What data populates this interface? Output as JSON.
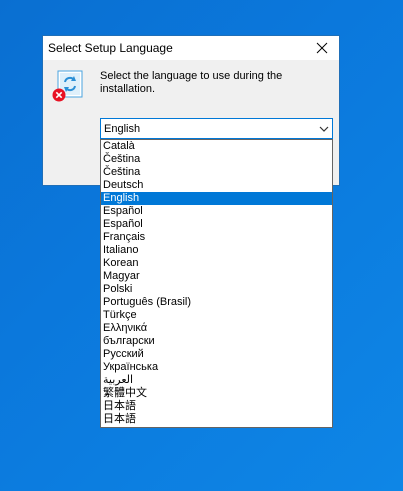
{
  "dialog": {
    "title": "Select Setup Language",
    "prompt": "Select the language to use during the installation."
  },
  "combo": {
    "selected": "English"
  },
  "options": [
    {
      "label": "Català"
    },
    {
      "label": "Čeština"
    },
    {
      "label": "Čeština"
    },
    {
      "label": "Deutsch"
    },
    {
      "label": "English"
    },
    {
      "label": "Español"
    },
    {
      "label": "Español"
    },
    {
      "label": "Français"
    },
    {
      "label": "Italiano"
    },
    {
      "label": "Korean"
    },
    {
      "label": "Magyar"
    },
    {
      "label": "Polski"
    },
    {
      "label": "Português (Brasil)"
    },
    {
      "label": "Türkçe"
    },
    {
      "label": "Ελληνικά"
    },
    {
      "label": "български"
    },
    {
      "label": "Русский"
    },
    {
      "label": "Українська"
    },
    {
      "label": "العربية"
    },
    {
      "label": "繁體中文"
    },
    {
      "label": "日本語"
    },
    {
      "label": "日本語"
    }
  ],
  "selected_index": 4,
  "colors": {
    "desktop": "#0b78dc",
    "accent": "#0078d7",
    "dialog_bg": "#f0f0f0",
    "error_badge": "#e81123"
  },
  "icons": {
    "setup": "setup-refresh-icon",
    "error": "error-badge-icon",
    "close": "close-icon",
    "dropdown": "chevron-down-icon"
  }
}
